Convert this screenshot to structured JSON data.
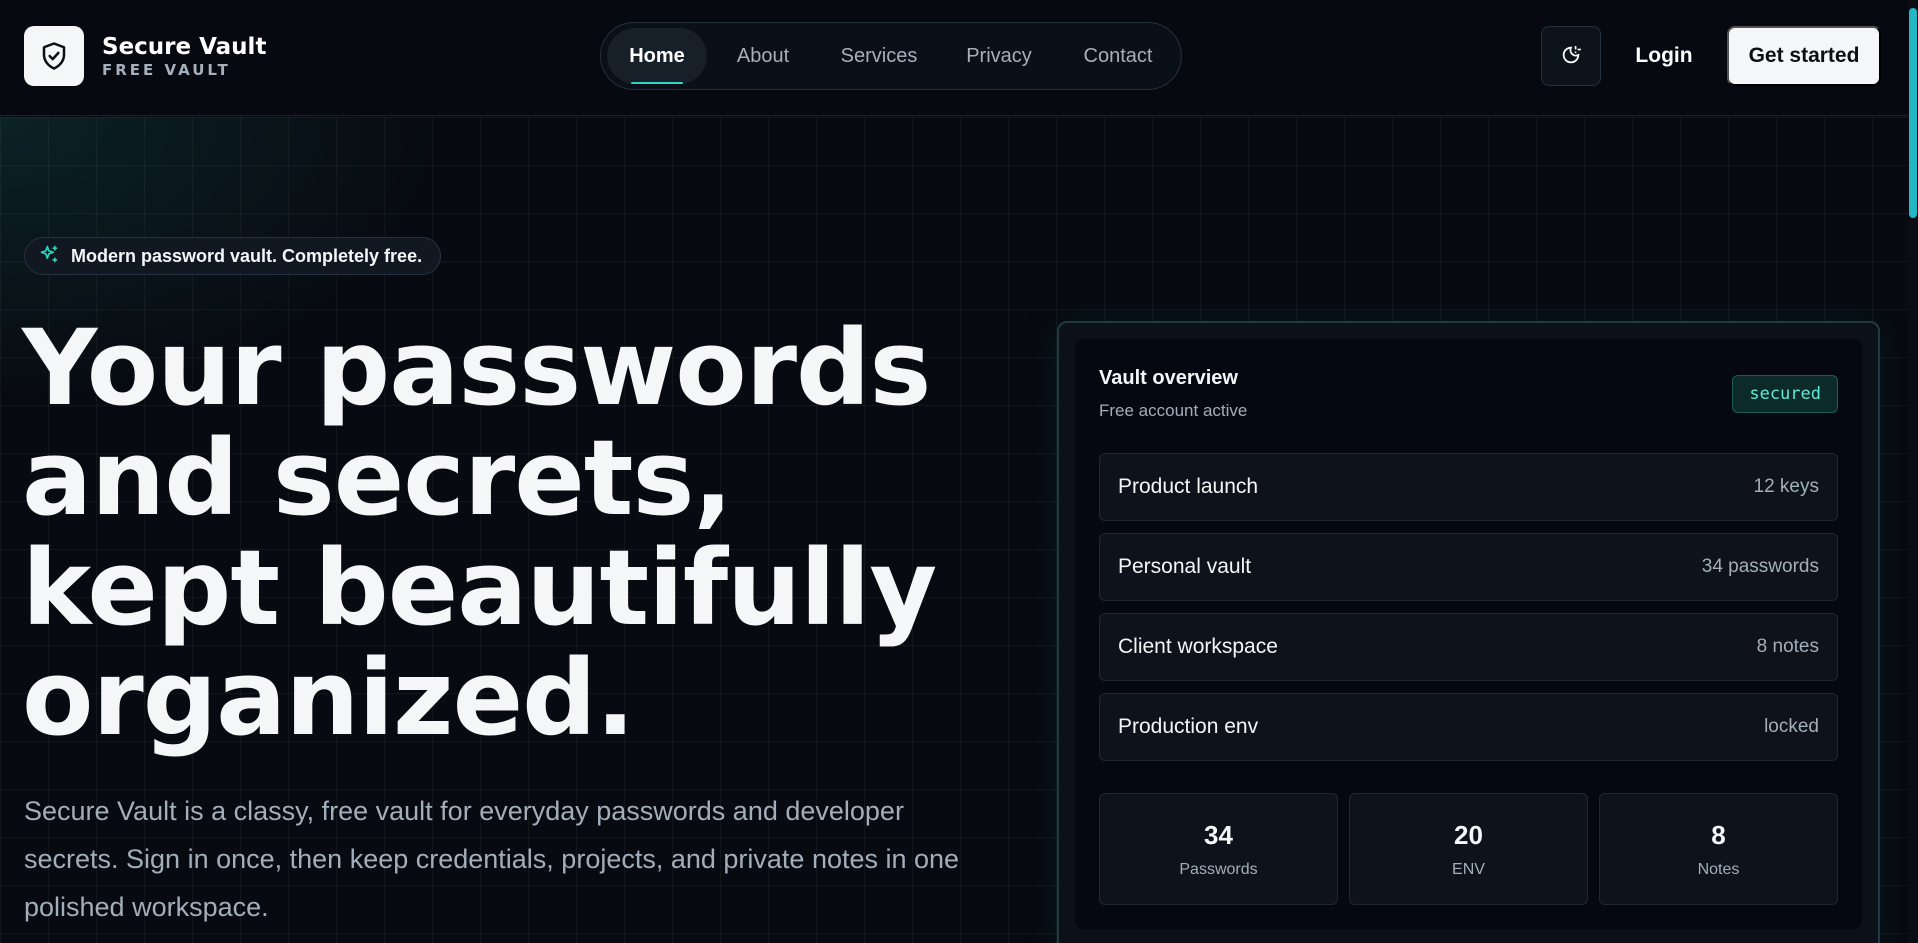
{
  "brand": {
    "name": "Secure Vault",
    "tagline": "FREE VAULT"
  },
  "nav": {
    "items": [
      {
        "label": "Home",
        "active": true
      },
      {
        "label": "About",
        "active": false
      },
      {
        "label": "Services",
        "active": false
      },
      {
        "label": "Privacy",
        "active": false
      },
      {
        "label": "Contact",
        "active": false
      }
    ]
  },
  "header_actions": {
    "theme_icon": "theme-toggle-icon",
    "login": "Login",
    "get_started": "Get started"
  },
  "hero": {
    "badge": "Modern password vault. Completely free.",
    "headline": "Your passwords and secrets, kept beautifully organized.",
    "subtext": "Secure Vault is a classy, free vault for everyday passwords and developer secrets. Sign in once, then keep credentials, projects, and private notes in one polished workspace."
  },
  "overview": {
    "title": "Vault overview",
    "subtitle": "Free account active",
    "status": "secured",
    "vaults": [
      {
        "name": "Product launch",
        "meta": "12 keys"
      },
      {
        "name": "Personal vault",
        "meta": "34 passwords"
      },
      {
        "name": "Client workspace",
        "meta": "8 notes"
      },
      {
        "name": "Production env",
        "meta": "locked"
      }
    ],
    "stats": [
      {
        "value": "34",
        "label": "Passwords"
      },
      {
        "value": "20",
        "label": "ENV"
      },
      {
        "value": "8",
        "label": "Notes"
      }
    ]
  },
  "colors": {
    "accent": "#2dd4bf",
    "background": "#070a10",
    "text": "#f4f6f8",
    "muted": "#a3aebb"
  }
}
